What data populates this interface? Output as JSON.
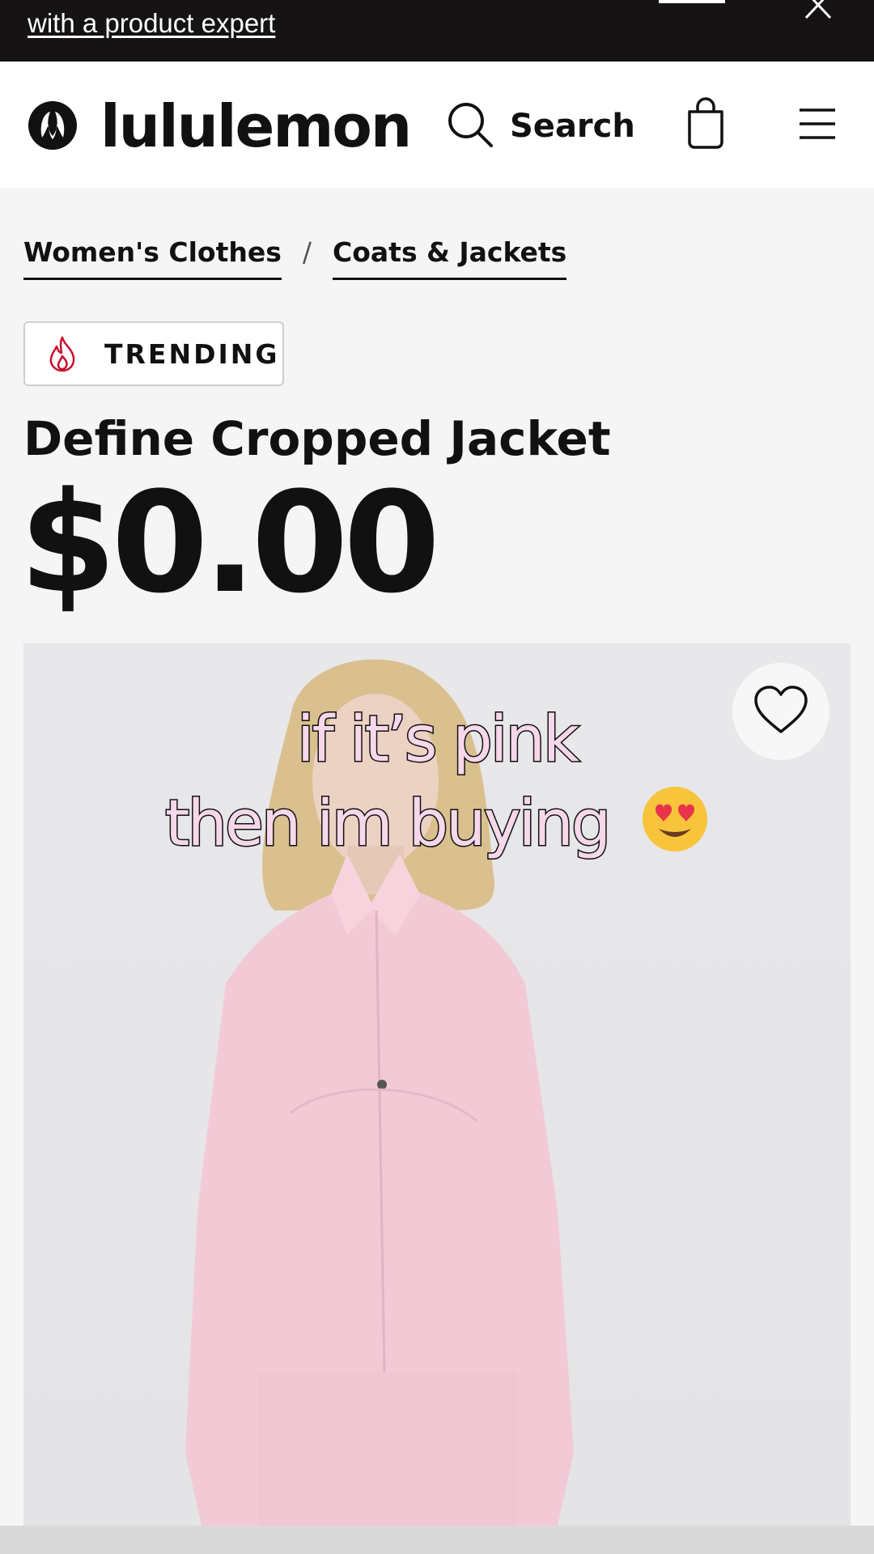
{
  "promo": {
    "link_text": "with a product expert",
    "close_icon": "close-icon"
  },
  "header": {
    "brand": "lululemon",
    "search_label": "Search",
    "icons": [
      "lululemon-logo-icon",
      "search-icon",
      "shopping-bag-icon",
      "hamburger-menu-icon"
    ]
  },
  "breadcrumb": {
    "items": [
      {
        "label": "Women's Clothes"
      },
      {
        "label": "Coats & Jackets"
      }
    ],
    "separator": "/"
  },
  "badge": {
    "label": "TRENDING",
    "icon": "flame-icon",
    "accent": "#c8102e"
  },
  "product": {
    "title": "Define Cropped Jacket",
    "price": "$0.00",
    "image_subject": "pink-jacket-photo",
    "favorite_icon": "heart-icon"
  },
  "overlay_caption": {
    "line1": "if it’s pink",
    "line2": "then im buying",
    "emoji": "heart-eyes-emoji",
    "color": "#f7d7ea"
  }
}
